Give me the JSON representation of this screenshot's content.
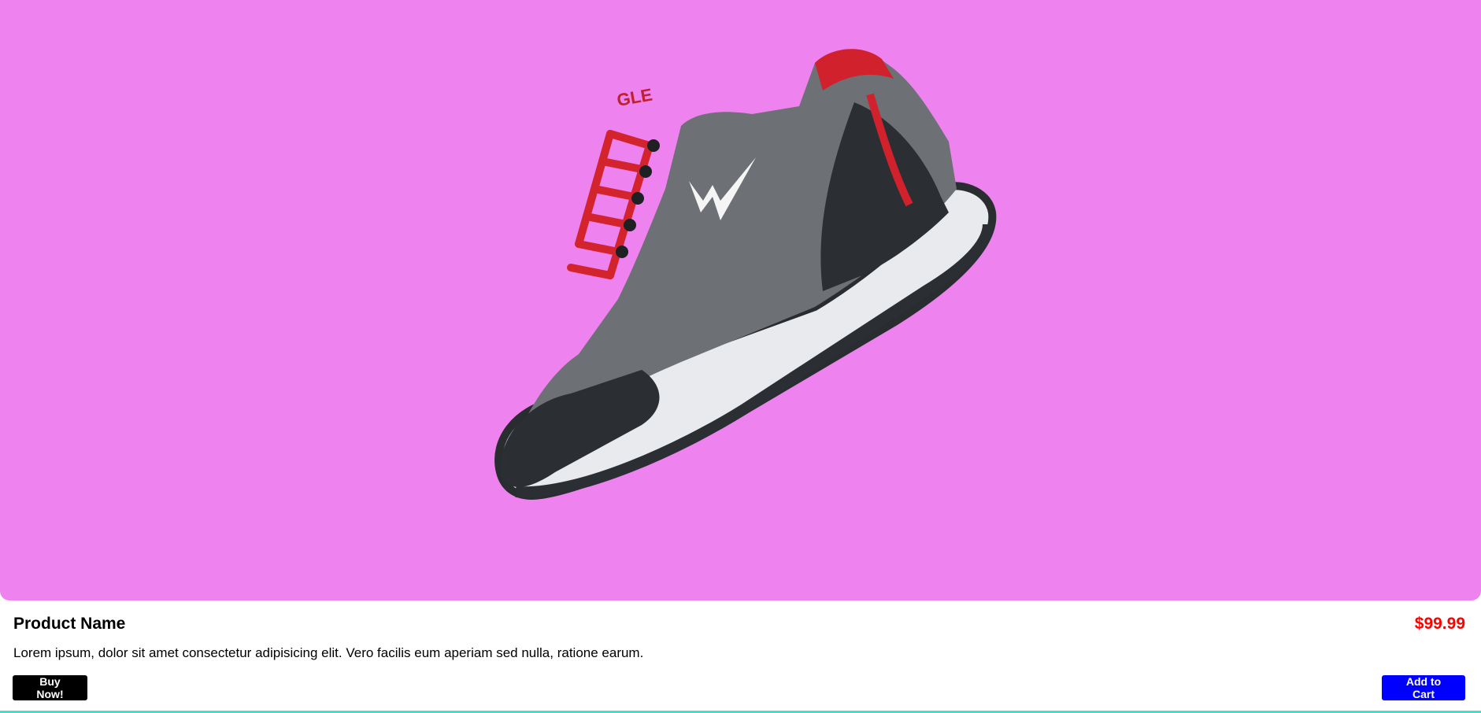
{
  "product": {
    "image_icon": "sneaker-image",
    "name": "Product Name",
    "price": "$99.99",
    "description": "Lorem ipsum, dolor sit amet consectetur adipisicing elit. Vero facilis eum aperiam sed nulla, ratione earum.",
    "buy_label": "Buy Now!",
    "cart_label": "Add to Cart"
  },
  "colors": {
    "image_background": "#ee82ee",
    "price": "#ff0000",
    "buy_button": "#000000",
    "cart_button": "#0000ff",
    "bottom_border": "#40e0d0"
  }
}
